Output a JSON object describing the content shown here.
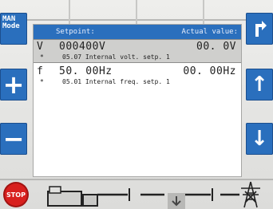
{
  "mode_button": {
    "line1": "MAN",
    "line2": "Mode"
  },
  "header": {
    "setpoint_label": "Setpoint:",
    "actual_label": "Actual value:"
  },
  "rows": [
    {
      "unit": "V",
      "setpoint": "000400V",
      "actual": "00. 0V",
      "marker": "*",
      "param": "05.07 Internal volt. setp. 1"
    },
    {
      "unit": "f",
      "setpoint": "50. 00Hz",
      "actual": "00. 00Hz",
      "marker": "*",
      "param": "05.01 Internal freq. setp. 1"
    }
  ],
  "keys": {
    "plus": "+",
    "minus": "−",
    "up": "↑",
    "down": "↓"
  },
  "stop_label": "STOP",
  "colors": {
    "button_blue": "#2a6fbd",
    "stop_red": "#d8201e",
    "selected_row": "#cfcfcd"
  },
  "icons": [
    "shortcut-arrow-icon",
    "up-arrow-icon",
    "down-arrow-icon",
    "generator-icon",
    "breaker-open-icon",
    "transmission-tower-icon"
  ]
}
